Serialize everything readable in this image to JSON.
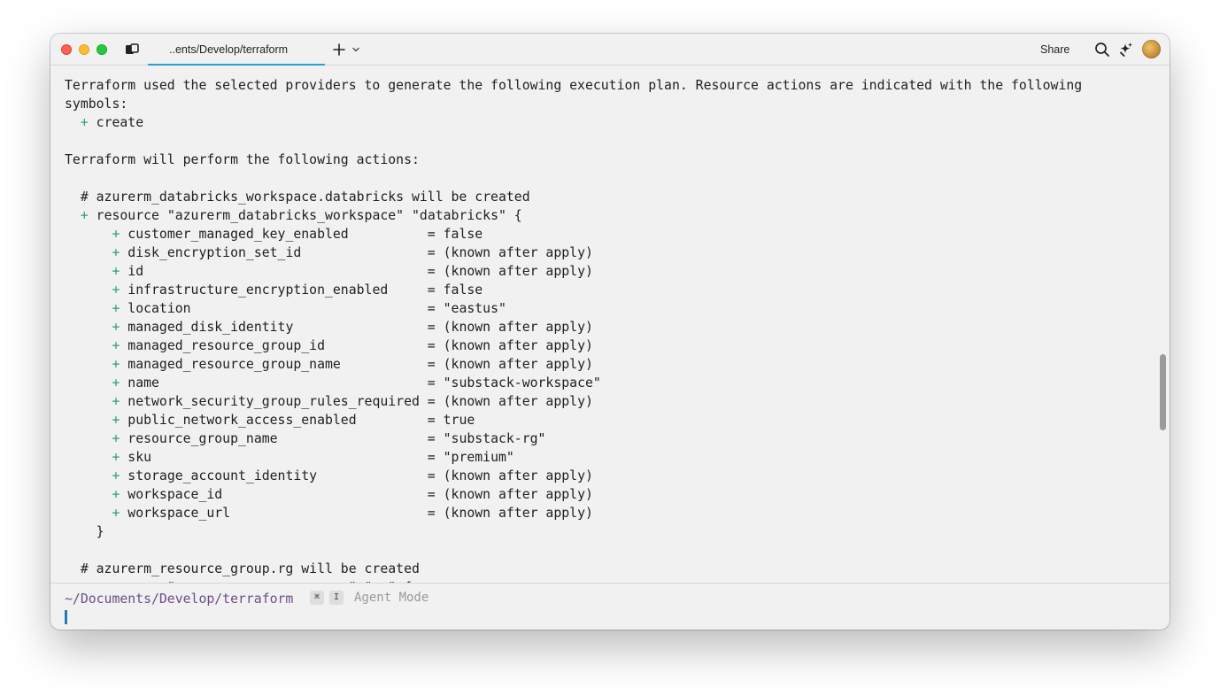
{
  "window": {
    "tab_title": "..ents/Develop/terraform",
    "share_label": "Share",
    "icons": [
      "panel-toggle-icon",
      "plus-icon",
      "chevron-down-icon",
      "search-icon",
      "sparkle-icon",
      "avatar"
    ]
  },
  "terminal": {
    "lines": [
      "Terraform used the selected providers to generate the following execution plan. Resource actions are indicated with the following",
      "symbols:",
      "  + create",
      "",
      "Terraform will perform the following actions:",
      "",
      "  # azurerm_databricks_workspace.databricks will be created",
      "  + resource \"azurerm_databricks_workspace\" \"databricks\" {",
      "      + customer_managed_key_enabled          = false",
      "      + disk_encryption_set_id                = (known after apply)",
      "      + id                                    = (known after apply)",
      "      + infrastructure_encryption_enabled     = false",
      "      + location                              = \"eastus\"",
      "      + managed_disk_identity                 = (known after apply)",
      "      + managed_resource_group_id             = (known after apply)",
      "      + managed_resource_group_name           = (known after apply)",
      "      + name                                  = \"substack-workspace\"",
      "      + network_security_group_rules_required = (known after apply)",
      "      + public_network_access_enabled         = true",
      "      + resource_group_name                   = \"substack-rg\"",
      "      + sku                                   = \"premium\"",
      "      + storage_account_identity              = (known after apply)",
      "      + workspace_id                          = (known after apply)",
      "      + workspace_url                         = (known after apply)",
      "    }",
      "",
      "  # azurerm_resource_group.rg will be created",
      "  + resource \"azurerm_resource_group\" \"rg\" {"
    ]
  },
  "input": {
    "cwd": "~/Documents/Develop/terraform",
    "shortcut_key1": "⌘",
    "shortcut_key2": "I",
    "agent_mode_label": "Agent Mode"
  },
  "colors": {
    "accent": "#2b9fd8",
    "plus_green": "#2e9e6e",
    "cwd_purple": "#6c4d89"
  }
}
